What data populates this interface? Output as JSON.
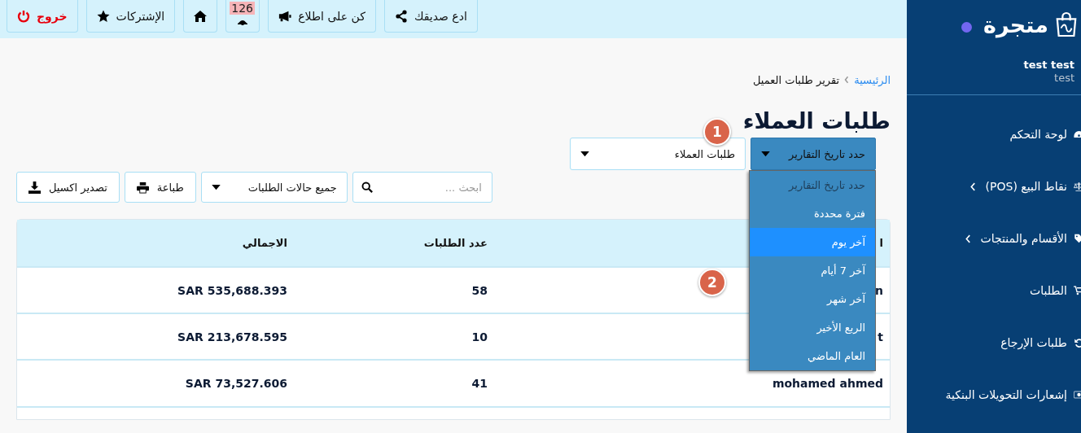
{
  "sidebar": {
    "logo_text": "متجرة",
    "user_name": "test test",
    "user_role": "test",
    "items": [
      {
        "label": "لوحة التحكم",
        "kind": "gauge",
        "has_children": false
      },
      {
        "label": "نقاط البيع (POS)",
        "kind": "scale",
        "has_children": true
      },
      {
        "label": "الأقسام والمنتجات",
        "kind": "tag",
        "has_children": true
      },
      {
        "label": "الطلبات",
        "kind": "cart",
        "has_children": false
      },
      {
        "label": "طلبات الإرجاع",
        "kind": "undo",
        "has_children": false
      },
      {
        "label": "إشعارات التحويلات البنكية",
        "kind": "money",
        "has_children": false
      }
    ]
  },
  "topbar": {
    "buttons": [
      {
        "kind": "share",
        "label": "ادع صديقك"
      },
      {
        "kind": "megaphone",
        "label": "كن على اطلاع"
      },
      {
        "kind": "bell",
        "badge": "126"
      },
      {
        "kind": "home"
      },
      {
        "kind": "star",
        "label": "الإشتركات"
      },
      {
        "kind": "logout",
        "label": "خروج"
      }
    ]
  },
  "breadcrumb": {
    "home": "الرئيسية",
    "current": "تقرير طلبات العميل"
  },
  "title": "طلبات العملاء",
  "annotations": [
    "1",
    "2"
  ],
  "date_filter": {
    "label": "حدد تاريخ التقارير",
    "expanded": true,
    "options": [
      {
        "label": "حدد تاريخ التقارير",
        "disabled": true,
        "selected": false
      },
      {
        "label": "فترة محددة",
        "disabled": false,
        "selected": false
      },
      {
        "label": "آخر يوم",
        "disabled": false,
        "selected": true
      },
      {
        "label": "آخر 7 أيام",
        "disabled": false,
        "selected": false
      },
      {
        "label": "آخر شهر",
        "disabled": false,
        "selected": false
      },
      {
        "label": "الربع الأخير",
        "disabled": false,
        "selected": false
      },
      {
        "label": "العام الماضي",
        "disabled": false,
        "selected": false
      }
    ]
  },
  "report_select": {
    "value": "طلبات العملاء"
  },
  "search": {
    "placeholder": "ابحث ..."
  },
  "status_select": {
    "value": "جميع حالات الطلبات"
  },
  "print_button": "طباعة",
  "export_button": "تصدير اكسيل",
  "table": {
    "columns": [
      "ا",
      "عدد الطلبات",
      "الاجمالي"
    ],
    "rows": [
      [
        "n",
        "58",
        "SAR 535,688.393"
      ],
      [
        "t",
        "10",
        "SAR 213,678.595"
      ],
      [
        "mohamed ahmed",
        "41",
        "SAR 73,527.606"
      ]
    ]
  }
}
